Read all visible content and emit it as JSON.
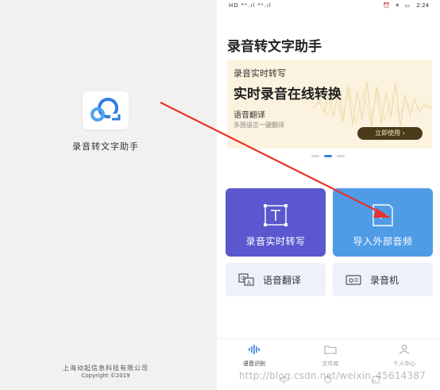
{
  "splash": {
    "app_name": "录音转文字助手",
    "company": "上海动起信息科技有限公司",
    "copyright": "Copyright ©2019"
  },
  "status_bar": {
    "left_text": "HD ⁴ᴳ.ıl ⁴ᴳ.ıl ",
    "right_icons": "⏰ ✶ ▭",
    "time": "2:24"
  },
  "home": {
    "title": "录音转文字助手",
    "banner": {
      "subtitle": "录音实时转写",
      "headline": "实时录音在线转换",
      "line2": "语音翻译",
      "line3": "多国语言一键翻译",
      "button": "立即使用 ›",
      "bg_color": "#fbf3df"
    },
    "carousel": {
      "count": 3,
      "active": 1
    },
    "feature_cards": [
      {
        "label": "录音实时转写",
        "icon": "text-box-icon",
        "color": "#5b58cf"
      },
      {
        "label": "导入外部音频",
        "icon": "import-file-icon",
        "color": "#4f9be6"
      }
    ],
    "small_cards": [
      {
        "label": "语音翻译",
        "icon": "translate-icon"
      },
      {
        "label": "录音机",
        "icon": "recorder-icon"
      }
    ]
  },
  "tabbar": {
    "tabs": [
      {
        "label": "语音识别",
        "icon": "waveform-icon",
        "active": true
      },
      {
        "label": "文件库",
        "icon": "folder-icon",
        "active": false
      },
      {
        "label": "个人中心",
        "icon": "person-icon",
        "active": false
      }
    ]
  },
  "watermark": "http://blog.csdn.net/weixin_45614387",
  "annotation": {
    "arrow_color": "#e8322e"
  }
}
